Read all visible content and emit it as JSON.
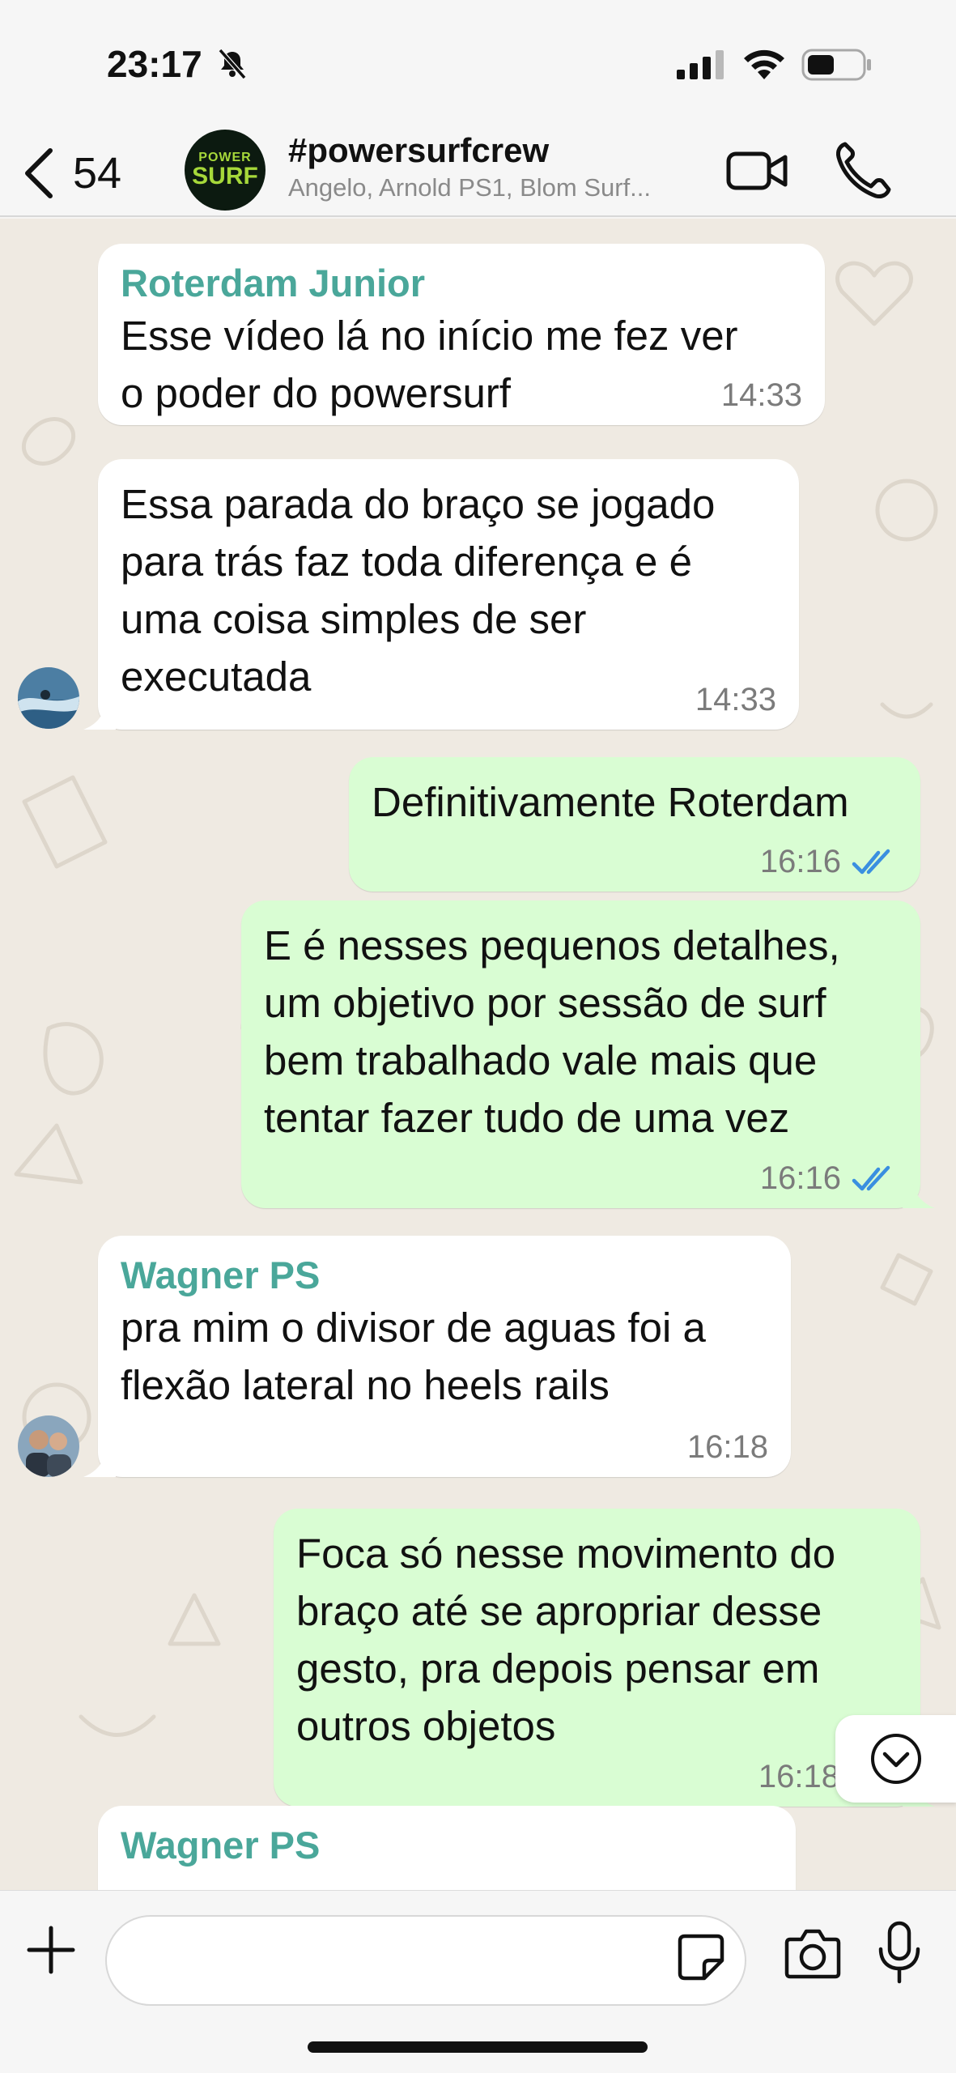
{
  "status_bar": {
    "time": "23:17"
  },
  "header": {
    "unread_count": "54",
    "avatar_line1": "POWER",
    "avatar_line2": "SURF",
    "group_name": "#powersurfcrew",
    "members": "Angelo, Arnold PS1, Blom Surf..."
  },
  "messages": [
    {
      "sender": "Roterdam Junior",
      "lines": [
        "Esse vídeo lá no início me fez  ver",
        "o poder do powersurf"
      ],
      "time": "14:33"
    },
    {
      "lines": [
        "Essa parada do braço se jogado",
        "para trás faz toda diferença e é",
        "uma coisa simples de ser",
        "executada"
      ],
      "time": "14:33"
    },
    {
      "lines": [
        "Definitivamente Roterdam"
      ],
      "time": "16:16"
    },
    {
      "lines": [
        "E é nesses pequenos detalhes,",
        "um objetivo por sessão de surf",
        "bem trabalhado vale mais que",
        "tentar fazer tudo de uma vez"
      ],
      "time": "16:16"
    },
    {
      "sender": "Wagner PS",
      "lines": [
        "pra mim o divisor de aguas foi a",
        "flexão lateral no heels rails"
      ],
      "time": "16:18"
    },
    {
      "lines": [
        "Foca só nesse movimento do",
        "braço até se apropriar desse",
        "gesto, pra depois pensar em",
        "outros objetos"
      ],
      "time": "16:18"
    },
    {
      "sender": "Wagner PS"
    }
  ],
  "input": {
    "placeholder": ""
  },
  "colors": {
    "accent": "#4aa79a",
    "outgoing_bubble": "#d9fdd3",
    "read_ticks": "#3a8fe0"
  }
}
